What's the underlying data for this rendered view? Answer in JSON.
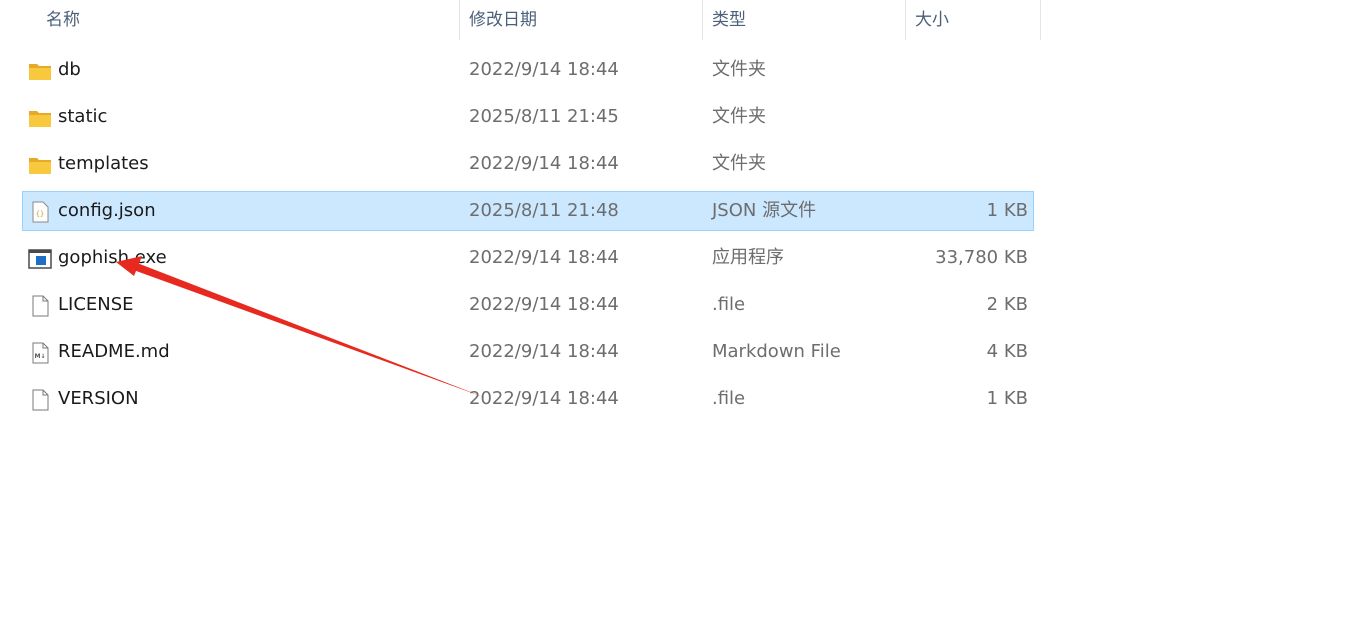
{
  "columns": {
    "name": "名称",
    "modified": "修改日期",
    "type": "类型",
    "size": "大小"
  },
  "files": [
    {
      "name": "db",
      "modified": "2022/9/14 18:44",
      "type": "文件夹",
      "size": "",
      "icon": "folder-icon"
    },
    {
      "name": "static",
      "modified": "2025/8/11 21:45",
      "type": "文件夹",
      "size": "",
      "icon": "folder-icon"
    },
    {
      "name": "templates",
      "modified": "2022/9/14 18:44",
      "type": "文件夹",
      "size": "",
      "icon": "folder-icon"
    },
    {
      "name": "config.json",
      "modified": "2025/8/11 21:48",
      "type": "JSON 源文件",
      "size": "1 KB",
      "icon": "json-file-icon",
      "selected": true
    },
    {
      "name": "gophish.exe",
      "modified": "2022/9/14 18:44",
      "type": "应用程序",
      "size": "33,780 KB",
      "icon": "exe-file-icon"
    },
    {
      "name": "LICENSE",
      "modified": "2022/9/14 18:44",
      "type": ".file",
      "size": "2 KB",
      "icon": "blank-file-icon"
    },
    {
      "name": "README.md",
      "modified": "2022/9/14 18:44",
      "type": "Markdown File",
      "size": "4 KB",
      "icon": "markdown-file-icon"
    },
    {
      "name": "VERSION",
      "modified": "2022/9/14 18:44",
      "type": ".file",
      "size": "1 KB",
      "icon": "blank-file-icon"
    }
  ],
  "colors": {
    "selection_bg": "#cce8ff",
    "selection_border": "#99d1ff",
    "folder_yellow": "#f8c93e",
    "annotation_arrow": "#e8291f"
  },
  "annotation": {
    "type": "red-arrow",
    "points_to": "gophish.exe"
  }
}
